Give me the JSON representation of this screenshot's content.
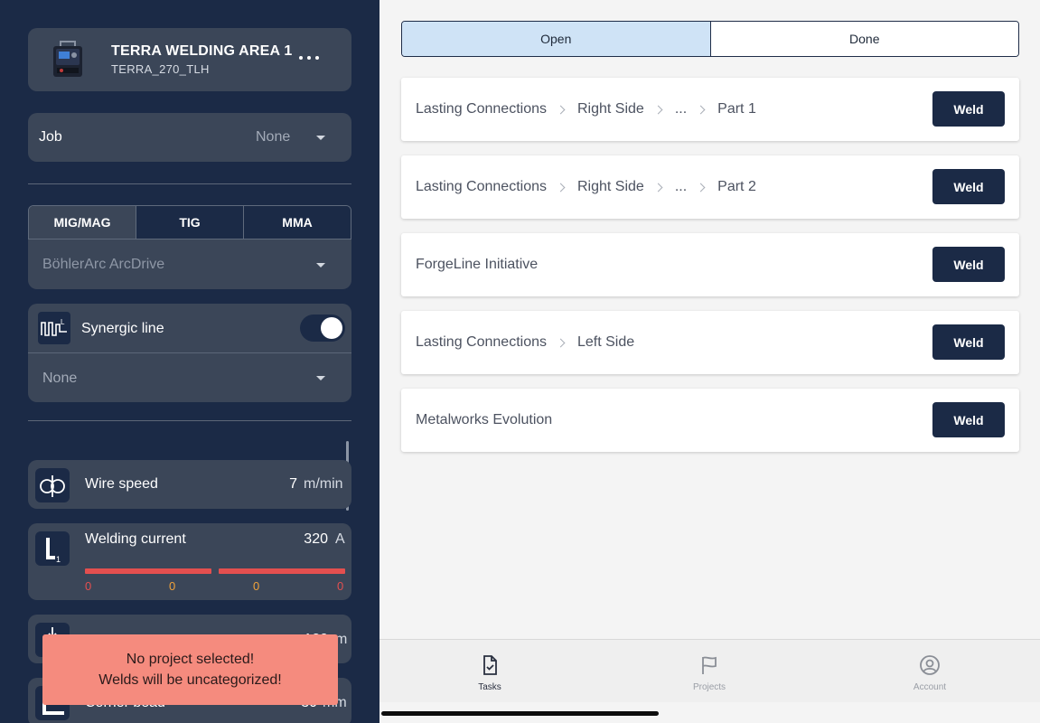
{
  "device": {
    "title": "TERRA WELDING AREA 1",
    "subtitle": "TERRA_270_TLH"
  },
  "job": {
    "label": "Job",
    "value": "None"
  },
  "process_tabs": [
    "MIG/MAG",
    "TIG",
    "MMA"
  ],
  "process_selected": "MIG/MAG",
  "wire": {
    "value": "BöhlerArc ArcDrive"
  },
  "synergic": {
    "label": "Synergic line",
    "enabled": true,
    "value": "None"
  },
  "params": {
    "wire_speed": {
      "label": "Wire speed",
      "value": "7",
      "unit": "m/min"
    },
    "welding_current": {
      "label": "Welding current",
      "value": "320",
      "unit": "A",
      "bars": [
        "0",
        "0",
        "0",
        "0"
      ]
    },
    "partial1": {
      "value": "120",
      "unit": "m"
    },
    "corner_bead": {
      "label": "Corner bead",
      "value": "30",
      "unit": "mm"
    }
  },
  "toast": {
    "line1": "No project selected!",
    "line2": "Welds will be uncategorized!"
  },
  "status_tabs": {
    "open": "Open",
    "done": "Done",
    "selected": "Open"
  },
  "tasks": [
    {
      "crumbs": [
        "Lasting Connections",
        "Right Side",
        "...",
        "Part 1"
      ],
      "action": "Weld"
    },
    {
      "crumbs": [
        "Lasting Connections",
        "Right Side",
        "...",
        "Part 2"
      ],
      "action": "Weld"
    },
    {
      "crumbs": [
        "ForgeLine Initiative"
      ],
      "action": "Weld"
    },
    {
      "crumbs": [
        "Lasting Connections",
        "Left Side"
      ],
      "action": "Weld"
    },
    {
      "crumbs": [
        "Metalworks Evolution"
      ],
      "action": "Weld"
    }
  ],
  "nav": {
    "tasks": {
      "label": "Tasks",
      "icon": "tasks-icon",
      "active": true
    },
    "projects": {
      "label": "Projects",
      "icon": "flag-icon",
      "active": false
    },
    "account": {
      "label": "Account",
      "icon": "account-icon",
      "active": false
    }
  },
  "colors": {
    "panel_dark": "#1b2a46",
    "card": "#3b4658",
    "toast": "#f58b7e",
    "bar_red": "#e34f4f",
    "bar_num_mid": "#f0a23a",
    "tab_active": "#cfe3f6"
  }
}
